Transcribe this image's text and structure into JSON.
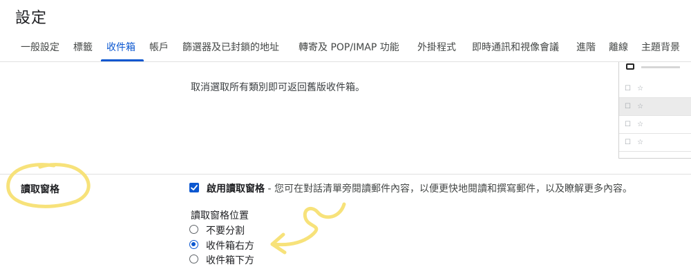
{
  "page": {
    "title": "設定"
  },
  "tabs": [
    {
      "label": "一般設定",
      "active": false
    },
    {
      "label": "標籤",
      "active": false
    },
    {
      "label": "收件箱",
      "active": true
    },
    {
      "label": "帳戶",
      "active": false
    },
    {
      "label": "篩選器及已封鎖的地址",
      "active": false
    },
    {
      "label": "轉寄及 POP/IMAP 功能",
      "active": false
    },
    {
      "label": "外掛程式",
      "active": false
    },
    {
      "label": "即時通訊和視像會議",
      "active": false
    },
    {
      "label": "進階",
      "active": false
    },
    {
      "label": "離線",
      "active": false
    },
    {
      "label": "主題背景",
      "active": false
    }
  ],
  "inbox_categories": {
    "note": "取消選取所有類別即可返回舊版收件箱。"
  },
  "reading_pane": {
    "label": "讀取窗格",
    "enable": {
      "checked": true,
      "label": "啟用讀取窗格",
      "description": " - 您可在對話清單旁閱讀郵件內容，以便更快地閱讀和撰寫郵件，以及瞭解更多內容。"
    },
    "position_title": "讀取窗格位置",
    "options": [
      {
        "label": "不要分割",
        "selected": false
      },
      {
        "label": "收件箱右方",
        "selected": true
      },
      {
        "label": "收件箱下方",
        "selected": false
      }
    ]
  },
  "preview": {
    "rows": [
      "☐ ☆",
      "☐ ☆",
      "☐ ☆",
      "☐ ☆"
    ]
  },
  "colors": {
    "accent": "#0b57d0",
    "annotation": "#f7e27a"
  }
}
